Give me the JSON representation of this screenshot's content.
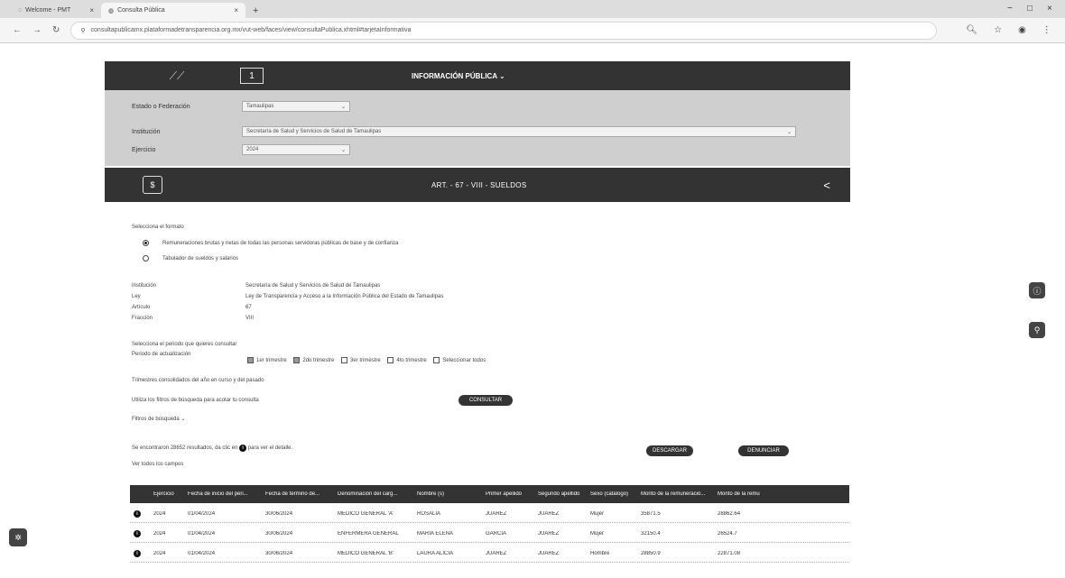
{
  "browser": {
    "tabs": [
      {
        "title": "Welcome - PMT",
        "active": false
      },
      {
        "title": "Consulta Pública",
        "active": true
      }
    ],
    "new_tab": "+",
    "url": "consultapublicamx.plataformadetransparencia.org.mx/vut-web/faces/view/consultaPublica.xhtml#tarjetaInformativa"
  },
  "header": {
    "title": "INFORMACIÓN PÚBLICA ⌄"
  },
  "filters": {
    "estado_label": "Estado o Federación",
    "estado_value": "Tamaulipas",
    "institucion_label": "Institución",
    "institucion_value": "Secretaría de Salud y Servicios de Salud de Tamaulipas",
    "ejercicio_label": "Ejercicio",
    "ejercicio_value": "2024"
  },
  "section": {
    "title": "ART. - 67 - VIII - SUELDOS"
  },
  "format": {
    "prompt": "Selecciona el formato",
    "option1": "Remuneraciones brutas y netas de todas las personas servidoras públicas de base y de confianza",
    "option2": "Tabulador de sueldos y salarios"
  },
  "details": {
    "institucion_label": "Institución",
    "institucion_value": "Secretaría de Salud y Servicios de Salud de Tamaulipas",
    "ley_label": "Ley",
    "ley_value": "Ley de Transparencia y Acceso a la Información Pública del Estado de Tamaulipas",
    "articulo_label": "Artículo",
    "articulo_value": "67",
    "fraccion_label": "Fracción",
    "fraccion_value": "VIII"
  },
  "period": {
    "prompt": "Selecciona el periodo que quieres consultar",
    "label": "Periodo de actualización",
    "options": [
      "1er trimestre",
      "2do trimestre",
      "3er trimestre",
      "4to trimestre",
      "Seleccionar todos"
    ],
    "note": "Trimestres consolidados del año en curso y del pasado"
  },
  "search": {
    "hint": "Utiliza los filtros de búsqueda para acotar tu consulta",
    "consult_button": "CONSULTAR",
    "filters_toggle": "Filtros de búsqueda ⌄"
  },
  "results": {
    "summary": "Se encontraron 28652 resultados, da clic en",
    "summary_suffix": "para ver el detalle.",
    "see_all": "Ver todos los campos",
    "download_button": "DESCARGAR",
    "report_button": "DENUNCIAR"
  },
  "table": {
    "headers": [
      "Ejercicio",
      "Fecha de inicio del peri...",
      "Fecha de término de...",
      "Denominación del carg...",
      "Nombre (s)",
      "Primer apellido",
      "Segundo apellido",
      "Sexo (catálogo)",
      "Monto de la remuneració...",
      "Monto de la remu"
    ],
    "rows": [
      [
        "2024",
        "01/04/2024",
        "30/06/2024",
        "MEDICO GENERAL 'A'",
        "ROSALIA",
        "JUAREZ",
        "JUAREZ",
        "Mujer",
        "35871.5",
        "28862.64"
      ],
      [
        "2024",
        "01/04/2024",
        "30/06/2024",
        "ENFERMERA GENERAL",
        "MARIA ELENA",
        "GARCIA",
        "JUAREZ",
        "Mujer",
        "32150.4",
        "26524.7"
      ],
      [
        "2024",
        "01/04/2024",
        "30/06/2024",
        "MEDICO GENERAL 'B'",
        "LAURA ALICIA",
        "JUAREZ",
        "JUAREZ",
        "Hombre",
        "28850.9",
        "22871.08"
      ]
    ]
  }
}
